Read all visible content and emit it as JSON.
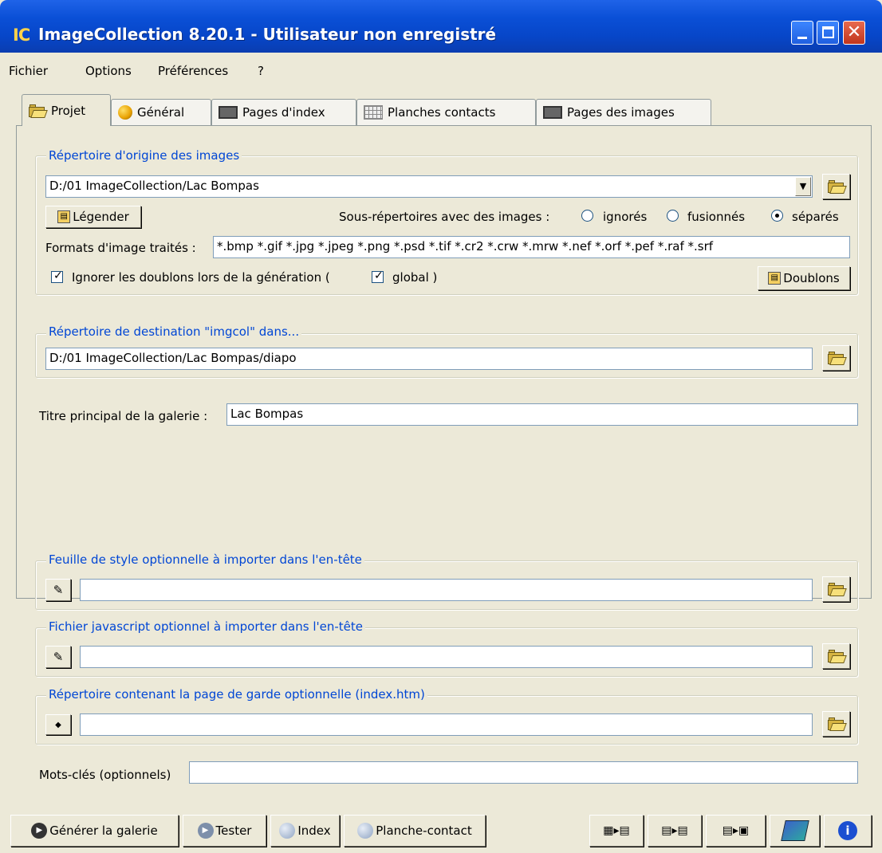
{
  "window": {
    "app_icon": "IC",
    "title": "ImageCollection 8.20.1 - Utilisateur non enregistré"
  },
  "menu": {
    "items": [
      "Fichier",
      "Options",
      "Préférences",
      "?"
    ]
  },
  "tabs": [
    {
      "label": "Projet",
      "icon": "folder-icon",
      "active": true
    },
    {
      "label": "Général",
      "icon": "palette-icon",
      "active": false
    },
    {
      "label": "Pages d'index",
      "icon": "film-icon",
      "active": false
    },
    {
      "label": "Planches contacts",
      "icon": "grid-icon",
      "active": false
    },
    {
      "label": "Pages des images",
      "icon": "image-icon",
      "active": false
    }
  ],
  "source": {
    "legend": "Répertoire d'origine des images",
    "path": "D:/01 ImageCollection/Lac Bompas",
    "caption_button": "Légender",
    "subdirs_label": "Sous-répertoires avec des images :",
    "subdir_options": [
      {
        "label": "ignorés",
        "selected": false
      },
      {
        "label": "fusionnés",
        "selected": false
      },
      {
        "label": "séparés",
        "selected": true
      }
    ],
    "formats_label": "Formats d'image traités :",
    "formats_value": "*.bmp *.gif *.jpg *.jpeg *.png *.psd *.tif *.cr2 *.crw *.mrw *.nef *.orf *.pef *.raf *.srf",
    "ignore_dupes_label": "Ignorer les doublons lors de la génération (",
    "ignore_dupes_checked": true,
    "global_label": "global )",
    "global_checked": true,
    "duplicates_button": "Doublons"
  },
  "destination": {
    "legend": "Répertoire de destination \"imgcol\" dans...",
    "path": "D:/01 ImageCollection/Lac Bompas/diapo"
  },
  "gallery_title": {
    "label": "Titre principal de la galerie :",
    "value": "Lac Bompas"
  },
  "stylesheet": {
    "legend": "Feuille de style optionnelle à importer dans l'en-tête",
    "value": ""
  },
  "javascript": {
    "legend": "Fichier javascript optionnel à importer dans l'en-tête",
    "value": ""
  },
  "cover_page": {
    "legend": "Répertoire contenant la page de garde optionnelle (index.htm)",
    "value": ""
  },
  "keywords": {
    "label": "Mots-clés (optionnels)",
    "value": ""
  },
  "toolbar": {
    "generate": "Générer la galerie",
    "test": "Tester",
    "index": "Index",
    "contact_sheet": "Planche-contact"
  }
}
